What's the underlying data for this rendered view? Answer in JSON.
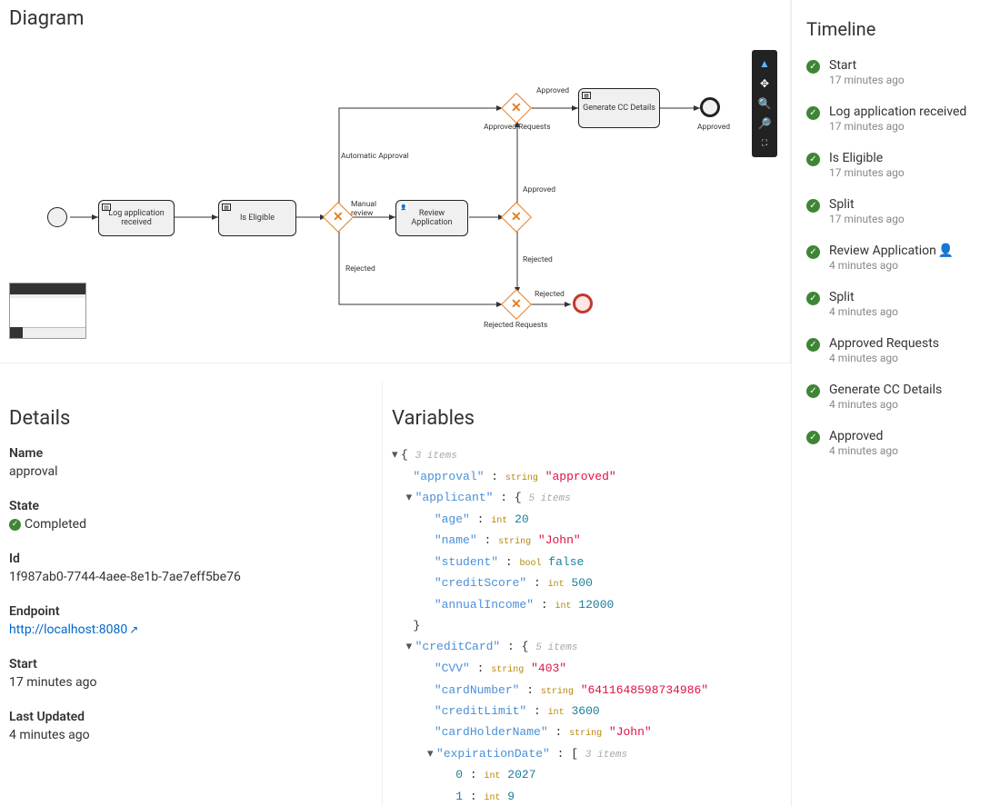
{
  "diagram": {
    "title": "Diagram",
    "nodes": {
      "start": "",
      "logApp": "Log application received",
      "isEligible": "Is Eligible",
      "reviewApp": "Review Application",
      "genCC": "Generate CC Details",
      "rejectedRequests": "Rejected Requests",
      "approvedRequests": "Approved Requests",
      "approved": "Approved"
    },
    "edgeLabels": {
      "automaticApproval": "Automatic Approval",
      "manualReview": "Manual review",
      "rejected": "Rejected",
      "approved": "Approved",
      "approvedBottom": "Approved",
      "rejectedBottom": "Rejected"
    }
  },
  "toolbar": {
    "pointer": "pointer",
    "move": "move",
    "zoomIn": "zoom-in",
    "zoomOut": "zoom-out",
    "fit": "fit"
  },
  "details": {
    "title": "Details",
    "labels": {
      "name": "Name",
      "state": "State",
      "id": "Id",
      "endpoint": "Endpoint",
      "start": "Start",
      "lastUpdated": "Last Updated"
    },
    "name": "approval",
    "state": "Completed",
    "id": "1f987ab0-7744-4aee-8e1b-7ae7eff5be76",
    "endpoint": "http://localhost:8080",
    "start": "17 minutes ago",
    "lastUpdated": "4 minutes ago"
  },
  "variables": {
    "title": "Variables",
    "rootCount": "3 items",
    "approval": {
      "type": "string",
      "value": "\"approved\""
    },
    "applicant": {
      "count": "5 items",
      "age": {
        "type": "int",
        "value": "20"
      },
      "name": {
        "type": "string",
        "value": "\"John\""
      },
      "student": {
        "type": "bool",
        "value": "false"
      },
      "creditScore": {
        "type": "int",
        "value": "500"
      },
      "annualIncome": {
        "type": "int",
        "value": "12000"
      }
    },
    "creditCard": {
      "count": "5 items",
      "CVV": {
        "type": "string",
        "value": "\"403\""
      },
      "cardNumber": {
        "type": "string",
        "value": "\"6411648598734986\""
      },
      "creditLimit": {
        "type": "int",
        "value": "3600"
      },
      "cardHolderName": {
        "type": "string",
        "value": "\"John\""
      },
      "expirationDate": {
        "count": "3 items",
        "i0": {
          "type": "int",
          "value": "2027"
        },
        "i1": {
          "type": "int",
          "value": "9"
        }
      }
    }
  },
  "timeline": {
    "title": "Timeline",
    "items": [
      {
        "label": "Start",
        "time": "17 minutes ago",
        "human": false
      },
      {
        "label": "Log application received",
        "time": "17 minutes ago",
        "human": false
      },
      {
        "label": "Is Eligible",
        "time": "17 minutes ago",
        "human": false
      },
      {
        "label": "Split",
        "time": "17 minutes ago",
        "human": false
      },
      {
        "label": "Review Application",
        "time": "4 minutes ago",
        "human": true
      },
      {
        "label": "Split",
        "time": "4 minutes ago",
        "human": false
      },
      {
        "label": "Approved Requests",
        "time": "4 minutes ago",
        "human": false
      },
      {
        "label": "Generate CC Details",
        "time": "4 minutes ago",
        "human": false
      },
      {
        "label": "Approved",
        "time": "4 minutes ago",
        "human": false
      }
    ]
  }
}
